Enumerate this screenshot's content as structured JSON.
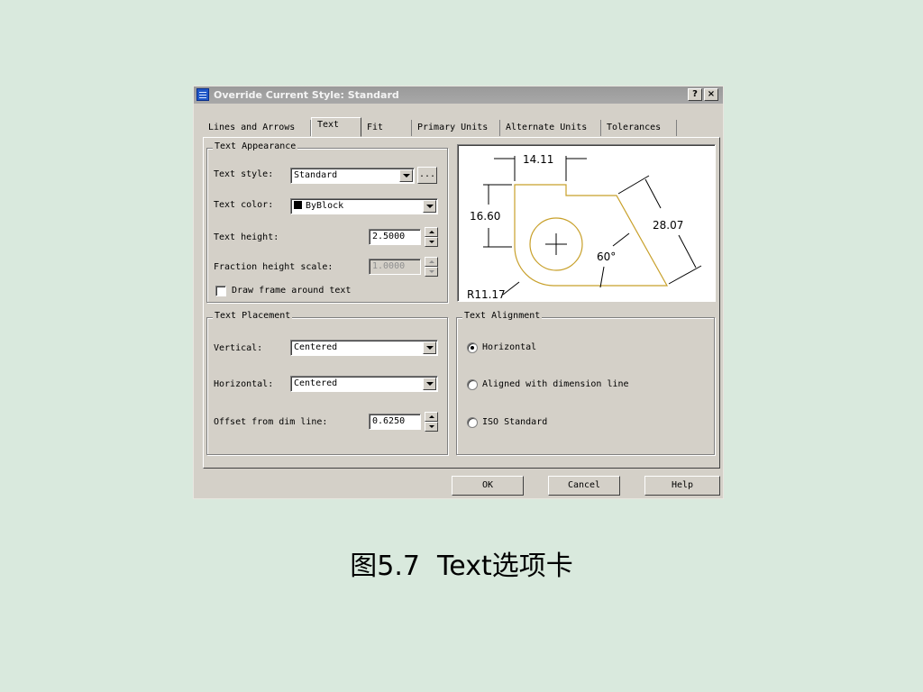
{
  "window": {
    "title": "Override Current Style: Standard",
    "help_btn": "?",
    "close_btn": "×"
  },
  "tabs": [
    {
      "label": "Lines and Arrows"
    },
    {
      "label": "Text"
    },
    {
      "label": "Fit"
    },
    {
      "label": "Primary Units"
    },
    {
      "label": "Alternate Units"
    },
    {
      "label": "Tolerances"
    }
  ],
  "text_appearance": {
    "title": "Text Appearance",
    "style_label": "Text style:",
    "style_value": "Standard",
    "style_browse": "...",
    "color_label": "Text color:",
    "color_value": "ByBlock",
    "height_label": "Text height:",
    "height_value": "2.5000",
    "fraction_label": "Fraction height scale:",
    "fraction_value": "1.0000",
    "frame_label": "Draw frame around text"
  },
  "text_placement": {
    "title": "Text Placement",
    "vertical_label": "Vertical:",
    "vertical_value": "Centered",
    "horizontal_label": "Horizontal:",
    "horizontal_value": "Centered",
    "offset_label": "Offset from dim line:",
    "offset_value": "0.6250"
  },
  "text_alignment": {
    "title": "Text Alignment",
    "options": [
      {
        "label": "Horizontal",
        "selected": true
      },
      {
        "label": "Aligned with dimension line",
        "selected": false
      },
      {
        "label": "ISO Standard",
        "selected": false
      }
    ]
  },
  "preview": {
    "dim_top": "14.11",
    "dim_left": "16.60",
    "dim_right": "28.07",
    "dim_angle": "60°",
    "dim_radius": "R11.17"
  },
  "buttons": {
    "ok": "OK",
    "cancel": "Cancel",
    "help": "Help"
  },
  "caption": {
    "prefix": "图",
    "number": "5.7",
    "tab_word": "Text",
    "suffix": "选项卡"
  },
  "colors": {
    "outline": "#c8a02a",
    "background": "#d9e9dd",
    "dialog": "#d4d0c8"
  }
}
